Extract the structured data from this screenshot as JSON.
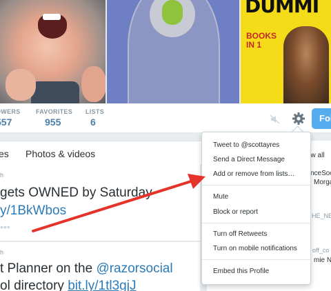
{
  "stats": [
    {
      "label": "OWERS",
      "value": "557"
    },
    {
      "label": "FAVORITES",
      "value": "955"
    },
    {
      "label": "LISTS",
      "value": "6"
    }
  ],
  "header": {
    "follow_label": "Fol"
  },
  "book": {
    "title": "DUMMI",
    "subtitle_1": "BOOKS",
    "subtitle_2": "IN 1"
  },
  "tabs": [
    {
      "label": "es"
    },
    {
      "label": "Photos & videos"
    }
  ],
  "tweets": [
    {
      "meta": "h",
      "line1": "gets OWNED by Saturday",
      "line2": "y/1BkWbos",
      "dots": "•••"
    },
    {
      "meta": "h",
      "line1_prefix": "t Planner on the ",
      "line1_link": "@razorsocial",
      "line2_prefix": "ol directory ",
      "line2_link": "bit.ly/1tl3gjJ"
    }
  ],
  "sidebar": {
    "view_all": "ew all",
    "items": [
      "nceSoc",
      "Morga",
      "HE_NEW",
      "off_co",
      "mie Nis"
    ]
  },
  "menu": {
    "items": [
      "Tweet to @scottayres",
      "Send a Direct Message",
      "Add or remove from lists…",
      "Mute",
      "Block or report",
      "Turn off Retweets",
      "Turn on mobile notifications",
      "Embed this Profile"
    ]
  },
  "colors": {
    "accent": "#55acee",
    "link": "#2b7bb9",
    "annotation_arrow": "#e5332a",
    "book_yellow": "#f4dc19"
  },
  "icons": {
    "mute": "speaker-muted-icon",
    "settings": "gear-icon"
  }
}
